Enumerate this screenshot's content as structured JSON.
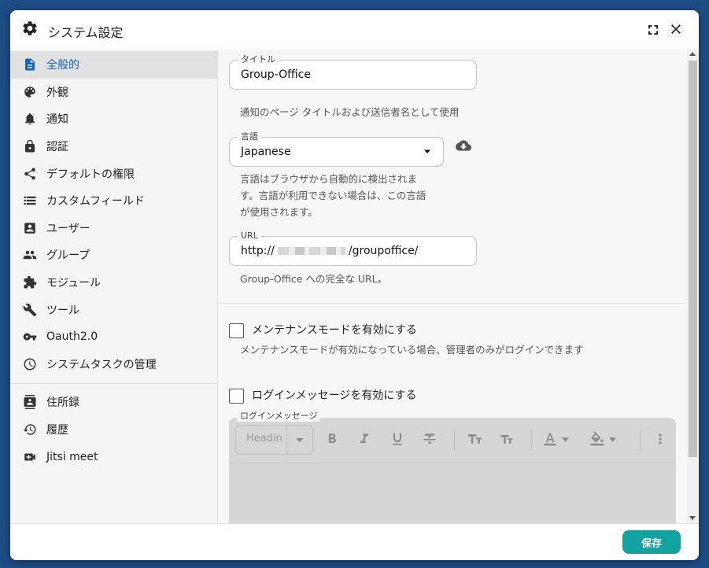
{
  "window": {
    "title": "システム設定"
  },
  "sidebar": {
    "items": [
      {
        "label": "全般的",
        "icon": "document-icon",
        "active": true
      },
      {
        "label": "外観",
        "icon": "palette-icon"
      },
      {
        "label": "通知",
        "icon": "bell-icon"
      },
      {
        "label": "認証",
        "icon": "lock-icon"
      },
      {
        "label": "デフォルトの権限",
        "icon": "share-icon"
      },
      {
        "label": "カスタムフィールド",
        "icon": "list-icon"
      },
      {
        "label": "ユーザー",
        "icon": "user-card-icon"
      },
      {
        "label": "グループ",
        "icon": "group-icon"
      },
      {
        "label": "モジュール",
        "icon": "puzzle-icon"
      },
      {
        "label": "ツール",
        "icon": "wrench-icon"
      },
      {
        "label": "Oauth2.0",
        "icon": "key-icon"
      },
      {
        "label": "システムタスクの管理",
        "icon": "clock-icon"
      }
    ],
    "modules": [
      {
        "label": "住所録",
        "icon": "contacts-icon"
      },
      {
        "label": "履歴",
        "icon": "history-icon"
      },
      {
        "label": "Jitsi meet",
        "icon": "video-icon"
      }
    ]
  },
  "general": {
    "title_field": {
      "label": "タイトル",
      "value": "Group-Office",
      "hint": "通知のページ タイトルおよび送信者名として使用"
    },
    "language_field": {
      "label": "言語",
      "value": "Japanese",
      "hint_lines": [
        "言語はブラウザから自動的に検出されま",
        "す。言語が利用できない場合は、この言語",
        "が使用されます。"
      ]
    },
    "url_field": {
      "label": "URL",
      "value_prefix": "http://",
      "value_suffix": "/groupoffice/",
      "hint": "Group-Office への完全な URL。"
    },
    "maintenance": {
      "label": "メンテナンスモードを有効にする",
      "hint": "メンテナンスモードが有効になっている場合、管理者のみがログインできます",
      "checked": false
    },
    "login_message": {
      "label": "ログインメッセージを有効にする",
      "checked": false,
      "editor_label": "ログインメッセージ",
      "heading_placeholder": "Headin"
    }
  },
  "footer": {
    "save_label": "保存"
  },
  "colors": {
    "accent": "#12a3a0",
    "active_nav": "#1565c0",
    "background": "#1e4d86"
  }
}
